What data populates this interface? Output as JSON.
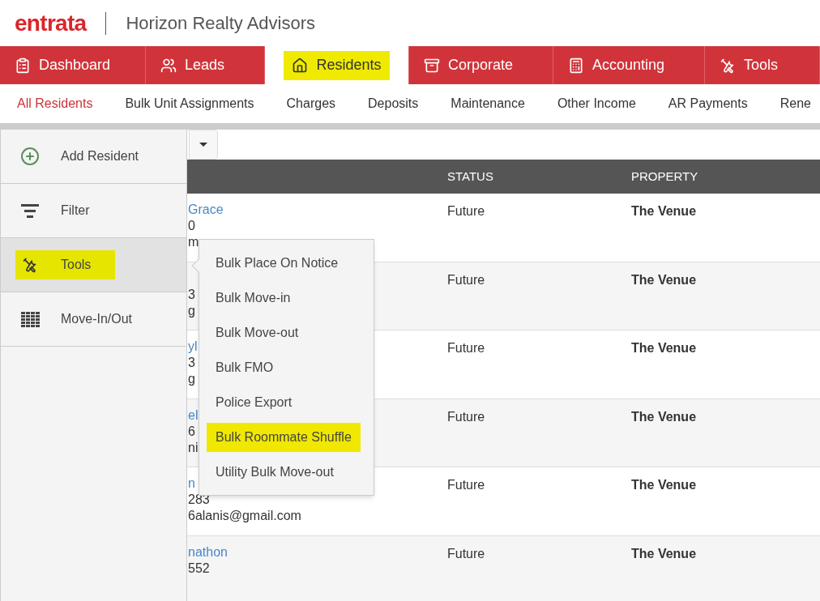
{
  "header": {
    "logo": "entrata",
    "company": "Horizon Realty Advisors"
  },
  "main_tabs": [
    {
      "label": "Dashboard",
      "selected": false,
      "highlighted": false
    },
    {
      "label": "Leads",
      "selected": false,
      "highlighted": false
    },
    {
      "label": "Residents",
      "selected": true,
      "highlighted": true
    },
    {
      "label": "Corporate",
      "selected": false,
      "highlighted": false
    },
    {
      "label": "Accounting",
      "selected": false,
      "highlighted": false
    },
    {
      "label": "Tools",
      "selected": false,
      "highlighted": false
    }
  ],
  "sub_tabs": [
    {
      "label": "All Residents",
      "selected": true
    },
    {
      "label": "Bulk Unit Assignments",
      "selected": false
    },
    {
      "label": "Charges",
      "selected": false
    },
    {
      "label": "Deposits",
      "selected": false
    },
    {
      "label": "Maintenance",
      "selected": false
    },
    {
      "label": "Other Income",
      "selected": false
    },
    {
      "label": "AR Payments",
      "selected": false
    },
    {
      "label": "Rene",
      "selected": false
    }
  ],
  "sidebar": {
    "items": [
      {
        "label": "Add Resident",
        "selected": false,
        "highlighted": false
      },
      {
        "label": "Filter",
        "selected": false,
        "highlighted": false
      },
      {
        "label": "Tools",
        "selected": true,
        "highlighted": true
      },
      {
        "label": "Move-In/Out",
        "selected": false,
        "highlighted": false
      }
    ]
  },
  "table": {
    "columns": [
      {
        "label": "STATUS"
      },
      {
        "label": "PROPERTY"
      }
    ],
    "rows": [
      {
        "name": "Grace",
        "line_2": "0",
        "line_3": "m",
        "status": "Future",
        "property": "The Venue"
      },
      {
        "line_2": "3",
        "line_3": "g",
        "status": "Future",
        "property": "The Venue"
      },
      {
        "name": "yl",
        "line_2": "3",
        "line_3": "g",
        "status": "Future",
        "property": "The Venue"
      },
      {
        "name": "el",
        "line_2": "6",
        "line_3": "ni",
        "status": "Future",
        "property": "The Venue"
      },
      {
        "name": "n",
        "line_2": "283",
        "line_3": "6alanis@gmail.com",
        "status": "Future",
        "property": "The Venue"
      },
      {
        "name": "nathon",
        "line_2": "552",
        "status": "Future",
        "property": "The Venue"
      }
    ]
  },
  "tools_menu": {
    "items": [
      {
        "label": "Bulk Place On Notice",
        "highlighted": false
      },
      {
        "label": "Bulk Move-in",
        "highlighted": false
      },
      {
        "label": "Bulk Move-out",
        "highlighted": false
      },
      {
        "label": "Bulk FMO",
        "highlighted": false
      },
      {
        "label": "Police Export",
        "highlighted": false
      },
      {
        "label": "Bulk Roommate Shuffle",
        "highlighted": true
      },
      {
        "label": "Utility Bulk Move-out",
        "highlighted": false
      }
    ]
  }
}
